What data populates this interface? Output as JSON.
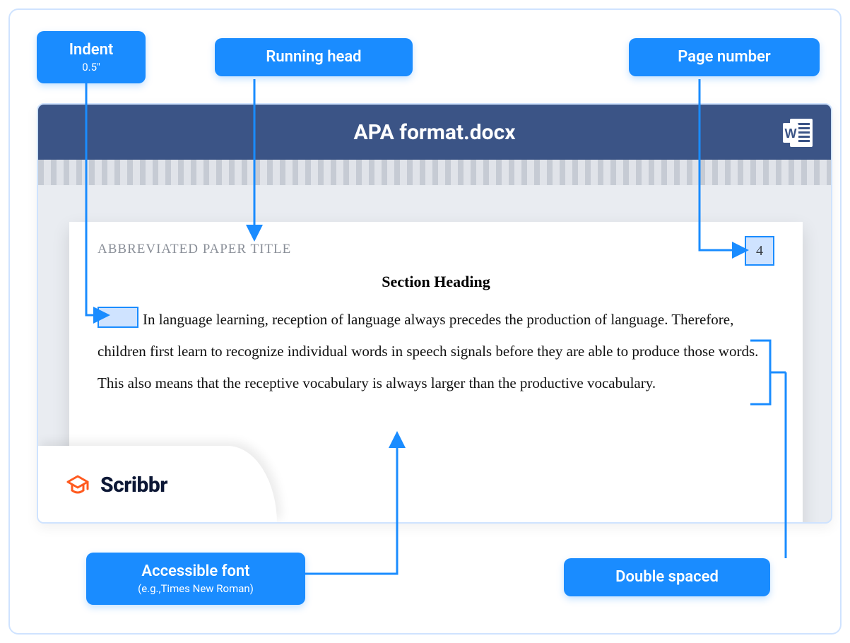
{
  "labels": {
    "indent": "Indent",
    "indent_sub": "0.5\"",
    "running_head": "Running head",
    "page_number": "Page number",
    "accessible_font": "Accessible font",
    "accessible_font_sub": "(e.g.,Times New Roman)",
    "double_spaced": "Double spaced"
  },
  "document": {
    "filename": "APA format.docx",
    "running_head_text": "ABBREVIATED PAPER TITLE",
    "page_number": "4",
    "section_heading": "Section Heading",
    "body": "In language learning, reception of language always precedes the production of language. Therefore, children first learn to recognize individual words in speech signals before they are able to produce those words. This also means that the receptive vocabulary is always larger than the productive vocabulary."
  },
  "brand": {
    "name": "Scribbr"
  }
}
